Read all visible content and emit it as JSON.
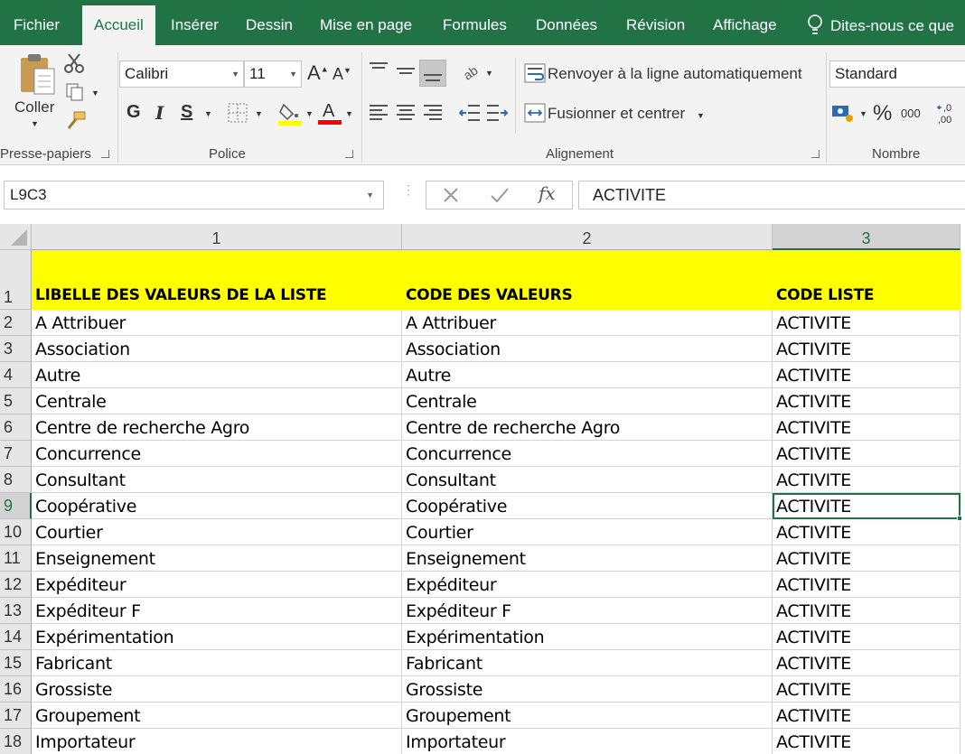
{
  "tabs": [
    {
      "label": "Fichier",
      "active": false
    },
    {
      "label": "Accueil",
      "active": true
    },
    {
      "label": "Insérer",
      "active": false
    },
    {
      "label": "Dessin",
      "active": false
    },
    {
      "label": "Mise en page",
      "active": false
    },
    {
      "label": "Formules",
      "active": false
    },
    {
      "label": "Données",
      "active": false
    },
    {
      "label": "Révision",
      "active": false
    },
    {
      "label": "Affichage",
      "active": false
    }
  ],
  "tell_me": "Dites-nous ce que",
  "ribbon": {
    "clipboard": {
      "group_label": "Presse-papiers",
      "paste_label": "Coller"
    },
    "font": {
      "group_label": "Police",
      "font_name": "Calibri",
      "font_size": "11",
      "bold": "G",
      "italic": "I",
      "underline": "S",
      "fill_color": "#ffff00",
      "font_color": "#ff0000"
    },
    "alignment": {
      "group_label": "Alignement",
      "wrap_label": "Renvoyer à la ligne automatiquement",
      "merge_label": "Fusionner et centrer"
    },
    "number": {
      "group_label": "Nombre",
      "format": "Standard",
      "percent": "%",
      "thousands": "000"
    }
  },
  "formula_bar": {
    "name_box": "L9C3",
    "fx": "fx",
    "content": "ACTIVITE"
  },
  "grid": {
    "columns": [
      "1",
      "2",
      "3"
    ],
    "selected_column": "3",
    "selected_row": "9",
    "header_row": {
      "row": "1",
      "cells": [
        "LIBELLE DES VALEURS DE LA LISTE",
        "CODE DES VALEURS",
        "CODE LISTE"
      ],
      "fill": "#ffff00"
    },
    "rows": [
      {
        "row": "2",
        "cells": [
          "A Attribuer",
          "A Attribuer",
          "ACTIVITE"
        ]
      },
      {
        "row": "3",
        "cells": [
          "Association",
          "Association",
          "ACTIVITE"
        ]
      },
      {
        "row": "4",
        "cells": [
          "Autre",
          "Autre",
          "ACTIVITE"
        ]
      },
      {
        "row": "5",
        "cells": [
          "Centrale",
          "Centrale",
          "ACTIVITE"
        ]
      },
      {
        "row": "6",
        "cells": [
          "Centre de recherche Agro",
          "Centre de recherche Agro",
          "ACTIVITE"
        ]
      },
      {
        "row": "7",
        "cells": [
          "Concurrence",
          "Concurrence",
          "ACTIVITE"
        ]
      },
      {
        "row": "8",
        "cells": [
          "Consultant",
          "Consultant",
          "ACTIVITE"
        ]
      },
      {
        "row": "9",
        "cells": [
          "Coopérative",
          "Coopérative",
          "ACTIVITE"
        ]
      },
      {
        "row": "10",
        "cells": [
          "Courtier",
          "Courtier",
          "ACTIVITE"
        ]
      },
      {
        "row": "11",
        "cells": [
          "Enseignement",
          "Enseignement",
          "ACTIVITE"
        ]
      },
      {
        "row": "12",
        "cells": [
          "Expéditeur",
          "Expéditeur",
          "ACTIVITE"
        ]
      },
      {
        "row": "13",
        "cells": [
          "Expéditeur F",
          "Expéditeur F",
          "ACTIVITE"
        ]
      },
      {
        "row": "14",
        "cells": [
          "Expérimentation",
          "Expérimentation",
          "ACTIVITE"
        ]
      },
      {
        "row": "15",
        "cells": [
          "Fabricant",
          "Fabricant",
          "ACTIVITE"
        ]
      },
      {
        "row": "16",
        "cells": [
          "Grossiste",
          "Grossiste",
          "ACTIVITE"
        ]
      },
      {
        "row": "17",
        "cells": [
          "Groupement",
          "Groupement",
          "ACTIVITE"
        ]
      },
      {
        "row": "18",
        "cells": [
          "Importateur",
          "Importateur",
          "ACTIVITE"
        ]
      }
    ]
  },
  "colors": {
    "excel_green": "#217346",
    "ribbon_bg": "#f3f3f3",
    "header_fill": "#ffff00"
  }
}
